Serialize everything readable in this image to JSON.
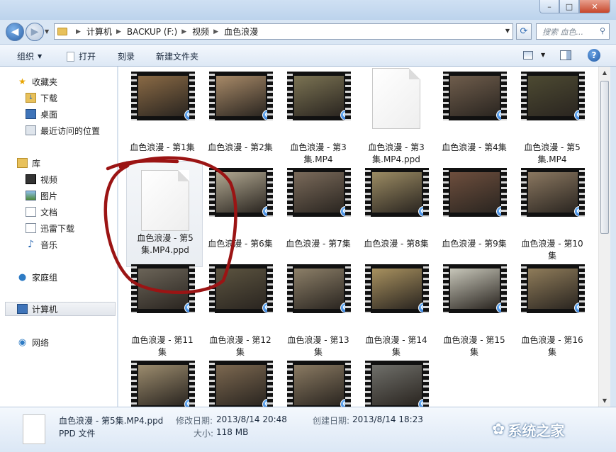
{
  "window": {
    "minimize": "–",
    "maximize": "□",
    "close": "✕"
  },
  "address": {
    "crumbs": [
      "计算机",
      "BACKUP (F:)",
      "视频",
      "血色浪漫"
    ],
    "search_placeholder": "搜索 血色..."
  },
  "toolbar": {
    "organize": "组织",
    "open": "打开",
    "burn": "刻录",
    "new_folder": "新建文件夹"
  },
  "sidebar": {
    "favorites": "收藏夹",
    "downloads": "下载",
    "desktop": "桌面",
    "recent": "最近访问的位置",
    "libraries": "库",
    "videos": "视频",
    "pictures": "图片",
    "documents": "文档",
    "thunder": "迅雷下载",
    "music": "音乐",
    "homegroup": "家庭组",
    "computer": "计算机",
    "network": "网络"
  },
  "files": [
    {
      "line1": "血色浪漫 - 第1集",
      "line2": "",
      "kind": "video",
      "color": "#8a6a45"
    },
    {
      "line1": "血色浪漫 - 第2集",
      "line2": "",
      "kind": "video",
      "color": "#a88a68"
    },
    {
      "line1": "血色浪漫 - 第3",
      "line2": "集.MP4",
      "kind": "video",
      "color": "#7b7353"
    },
    {
      "line1": "血色浪漫 - 第3",
      "line2": "集.MP4.ppd",
      "kind": "doc",
      "color": ""
    },
    {
      "line1": "血色浪漫 - 第4集",
      "line2": "",
      "kind": "video",
      "color": "#6f5d4c"
    },
    {
      "line1": "血色浪漫 - 第5",
      "line2": "集.MP4",
      "kind": "video",
      "color": "#4d4a32"
    },
    {
      "line1": "血色浪漫 - 第5",
      "line2": "集.MP4.ppd",
      "kind": "doc",
      "color": ""
    },
    {
      "line1": "血色浪漫 - 第6集",
      "line2": "",
      "kind": "video",
      "color": "#b1a891"
    },
    {
      "line1": "血色浪漫 - 第7集",
      "line2": "",
      "kind": "video",
      "color": "#7a6a5a"
    },
    {
      "line1": "血色浪漫 - 第8集",
      "line2": "",
      "kind": "video",
      "color": "#9b8b63"
    },
    {
      "line1": "血色浪漫 - 第9集",
      "line2": "",
      "kind": "video",
      "color": "#6d4e3d"
    },
    {
      "line1": "血色浪漫 - 第10",
      "line2": "集",
      "kind": "video",
      "color": "#8a7760"
    },
    {
      "line1": "血色浪漫 - 第11",
      "line2": "集",
      "kind": "video",
      "color": "#6b6458"
    },
    {
      "line1": "血色浪漫 - 第12",
      "line2": "集",
      "kind": "video",
      "color": "#5c5440"
    },
    {
      "line1": "血色浪漫 - 第13",
      "line2": "集",
      "kind": "video",
      "color": "#8c7f68"
    },
    {
      "line1": "血色浪漫 - 第14",
      "line2": "集",
      "kind": "video",
      "color": "#a8915f"
    },
    {
      "line1": "血色浪漫 - 第15",
      "line2": "集",
      "kind": "video",
      "color": "#c7c6b9"
    },
    {
      "line1": "血色浪漫 - 第16",
      "line2": "集",
      "kind": "video",
      "color": "#8f7c5a"
    },
    {
      "line1": "",
      "line2": "",
      "kind": "video",
      "color": "#9c8c6e"
    },
    {
      "line1": "",
      "line2": "",
      "kind": "video",
      "color": "#7c6850"
    },
    {
      "line1": "",
      "line2": "",
      "kind": "video",
      "color": "#8a7a62"
    },
    {
      "line1": "",
      "line2": "",
      "kind": "video",
      "color": "#6f6f6a"
    }
  ],
  "details": {
    "filename": "血色浪漫 - 第5集.MP4.ppd",
    "filetype": "PPD 文件",
    "modified_label": "修改日期:",
    "modified_value": "2013/8/14 20:48",
    "size_label": "大小:",
    "size_value": "118 MB",
    "created_label": "创建日期:",
    "created_value": "2013/8/14 18:23"
  },
  "watermark": {
    "text": "系统之家"
  },
  "colors": {
    "annotation": "#9b1414",
    "accent": "#2c62a8"
  }
}
